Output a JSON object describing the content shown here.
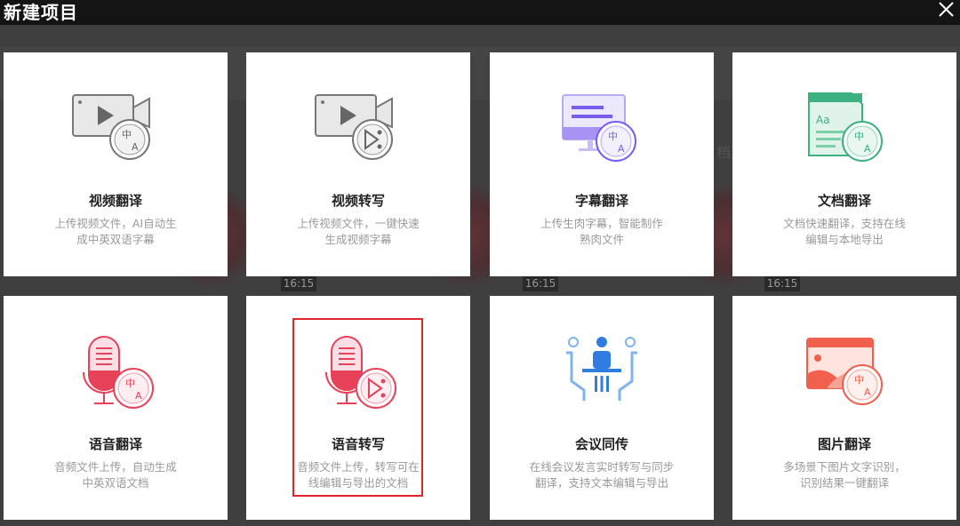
{
  "modal": {
    "title": "新建项目",
    "close_icon": "close-icon"
  },
  "background": {
    "time_labels": [
      "16:15",
      "16:15",
      "16:15"
    ],
    "fragment_text": "档"
  },
  "cards": [
    {
      "title": "视频翻译",
      "desc": "上传视频文件，AI自动生成中英双语字幕",
      "icon": "video-translate-icon"
    },
    {
      "title": "视频转写",
      "desc": "上传视频文件，一键快速生成视频字幕",
      "icon": "video-transcribe-icon"
    },
    {
      "title": "字幕翻译",
      "desc": "上传生肉字幕，智能制作熟肉文件",
      "icon": "subtitle-translate-icon"
    },
    {
      "title": "文档翻译",
      "desc": "文档快速翻译，支持在线编辑与本地导出",
      "icon": "document-translate-icon"
    },
    {
      "title": "语音翻译",
      "desc": "音频文件上传，自动生成中英双语文档",
      "icon": "audio-translate-icon"
    },
    {
      "title": "语音转写",
      "desc": "音频文件上传，转写可在线编辑与导出的文档",
      "icon": "audio-transcribe-icon",
      "highlighted": true
    },
    {
      "title": "会议同传",
      "desc": "在线会议发言实时转写与同步翻译，支持文本编辑与导出",
      "icon": "meeting-interpret-icon"
    },
    {
      "title": "图片翻译",
      "desc": "多场景下图片文字识别，识别结果一键翻译",
      "icon": "image-translate-icon"
    }
  ],
  "colors": {
    "highlight": "#e0262b",
    "header_bg": "#141414",
    "card_bg": "#ffffff",
    "pink_accent": "#e8415a",
    "purple_accent": "#7a5cf0",
    "green_accent": "#3cb07e",
    "blue_accent": "#2f7de1",
    "coral_accent": "#f0604d"
  }
}
